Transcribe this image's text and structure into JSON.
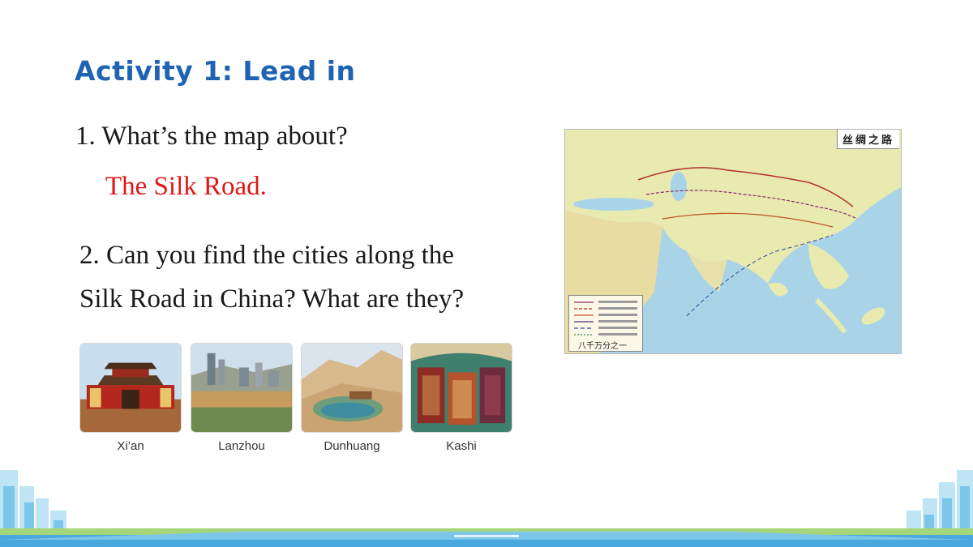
{
  "slide": {
    "title": "Activity 1: Lead in",
    "question1": "1. What’s the map about?",
    "answer1": "The Silk Road.",
    "question2_line1": "2. Can you find the cities along the",
    "question2_line2": "Silk Road in China? What are they?"
  },
  "cities": [
    {
      "name": "Xi’an"
    },
    {
      "name": "Lanzhou"
    },
    {
      "name": "Dunhuang"
    },
    {
      "name": "Kashi"
    }
  ],
  "map": {
    "title": "丝绸之路",
    "scale": "八千万分之一"
  },
  "colors": {
    "title": "#1f64b4",
    "answer": "#e21616",
    "land": "#e8eab0",
    "sea": "#a9d4e8"
  }
}
